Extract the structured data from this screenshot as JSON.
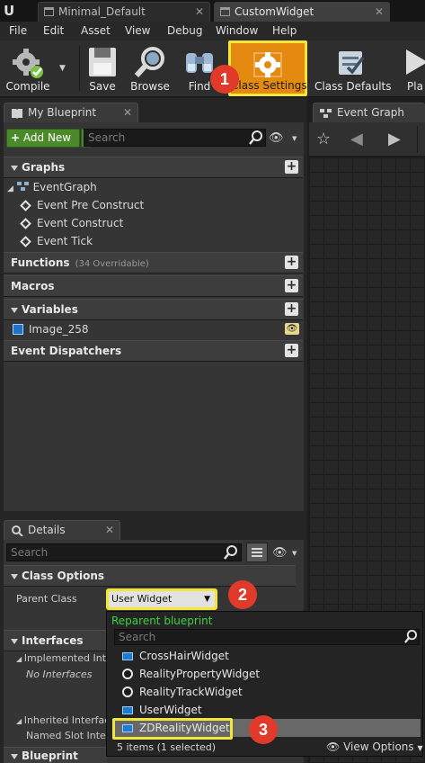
{
  "doc_tabs": [
    {
      "label": "Minimal_Default"
    },
    {
      "label": "CustomWidget"
    }
  ],
  "menu": [
    "File",
    "Edit",
    "Asset",
    "View",
    "Debug",
    "Window",
    "Help"
  ],
  "toolbar": {
    "compile": "Compile",
    "save": "Save",
    "browse": "Browse",
    "find": "Find",
    "class_settings": "Class Settings",
    "class_defaults": "Class Defaults",
    "play": "Pla"
  },
  "my_blueprint": {
    "tab_label": "My Blueprint",
    "add_new": "Add New",
    "search_placeholder": "Search",
    "sections": {
      "graphs": "Graphs",
      "functions": "Functions",
      "functions_count": "(34 Overridable)",
      "macros": "Macros",
      "variables": "Variables",
      "event_dispatchers": "Event Dispatchers"
    },
    "event_graph": "EventGraph",
    "events": [
      "Event Pre Construct",
      "Event Construct",
      "Event Tick"
    ],
    "variables": [
      "Image_258"
    ]
  },
  "event_graph_tab": "Event Graph",
  "details": {
    "tab_label": "Details",
    "search_placeholder": "Search",
    "class_options": "Class Options",
    "parent_class_label": "Parent Class",
    "parent_class_value": "User Widget",
    "interfaces": "Interfaces",
    "implemented_interfaces": "Implemented Interfa",
    "no_interfaces": "No Interfaces",
    "inherited_interfaces": "Inherited Interfaces",
    "named_slot_interface": "Named Slot Interf",
    "blueprint_options": "Blueprint Options"
  },
  "reparent_popup": {
    "title": "Reparent blueprint",
    "search_placeholder": "Search",
    "items": [
      "CrossHairWidget",
      "RealityPropertyWidget",
      "RealityTrackWidget",
      "UserWidget",
      "ZDRealityWidget"
    ],
    "selected": "ZDRealityWidget",
    "status": "5 items (1 selected)",
    "view_options": "View Options"
  },
  "badges": [
    "1",
    "2",
    "3"
  ],
  "colors": {
    "highlight_yellow": "#f2e53c",
    "badge_red": "#e03a2b",
    "add_new_green": "#4a8a2a",
    "reparent_title_green": "#3fd13f",
    "class_settings_orange": "#e58a10"
  }
}
